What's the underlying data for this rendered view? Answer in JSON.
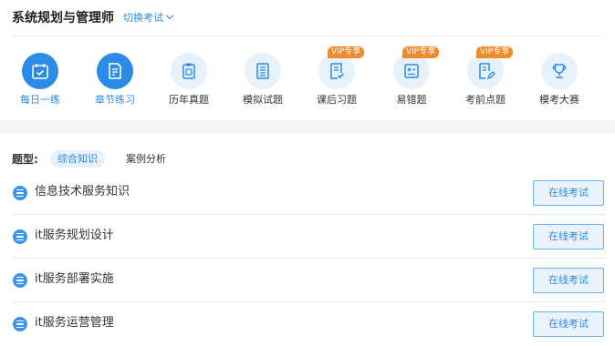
{
  "header": {
    "title": "系统规划与管理师",
    "switch_label": "切换考试"
  },
  "nav": {
    "items": [
      {
        "label": "每日一练",
        "active": true,
        "vip": "",
        "icon": "calendar-check-icon"
      },
      {
        "label": "章节练习",
        "active": true,
        "vip": "",
        "icon": "document-edit-icon"
      },
      {
        "label": "历年真题",
        "active": false,
        "vip": "",
        "icon": "clipboard-icon"
      },
      {
        "label": "模拟试题",
        "active": false,
        "vip": "",
        "icon": "building-doc-icon"
      },
      {
        "label": "课后习题",
        "active": false,
        "vip": "VIP专享",
        "icon": "checklist-icon"
      },
      {
        "label": "易错题",
        "active": false,
        "vip": "VIP专享",
        "icon": "error-card-icon"
      },
      {
        "label": "考前点题",
        "active": false,
        "vip": "VIP专享",
        "icon": "note-pen-icon"
      },
      {
        "label": "模考大赛",
        "active": false,
        "vip": "",
        "icon": "trophy-icon"
      }
    ]
  },
  "question_type": {
    "label": "题型:",
    "tabs": [
      {
        "label": "综合知识",
        "active": true
      },
      {
        "label": "案例分析",
        "active": false
      }
    ]
  },
  "list": {
    "rows": [
      {
        "title": "信息技术服务知识",
        "button": "在线考试"
      },
      {
        "title": "it服务规划设计",
        "button": "在线考试"
      },
      {
        "title": "it服务部署实施",
        "button": "在线考试"
      },
      {
        "title": "it服务运营管理",
        "button": "在线考试"
      }
    ]
  },
  "colors": {
    "accent": "#2b8be6",
    "icon_bg": "#e7f1fc",
    "vip": "#f08b2c",
    "button_bg": "#eaf3fc",
    "button_border": "#6aaeec"
  }
}
